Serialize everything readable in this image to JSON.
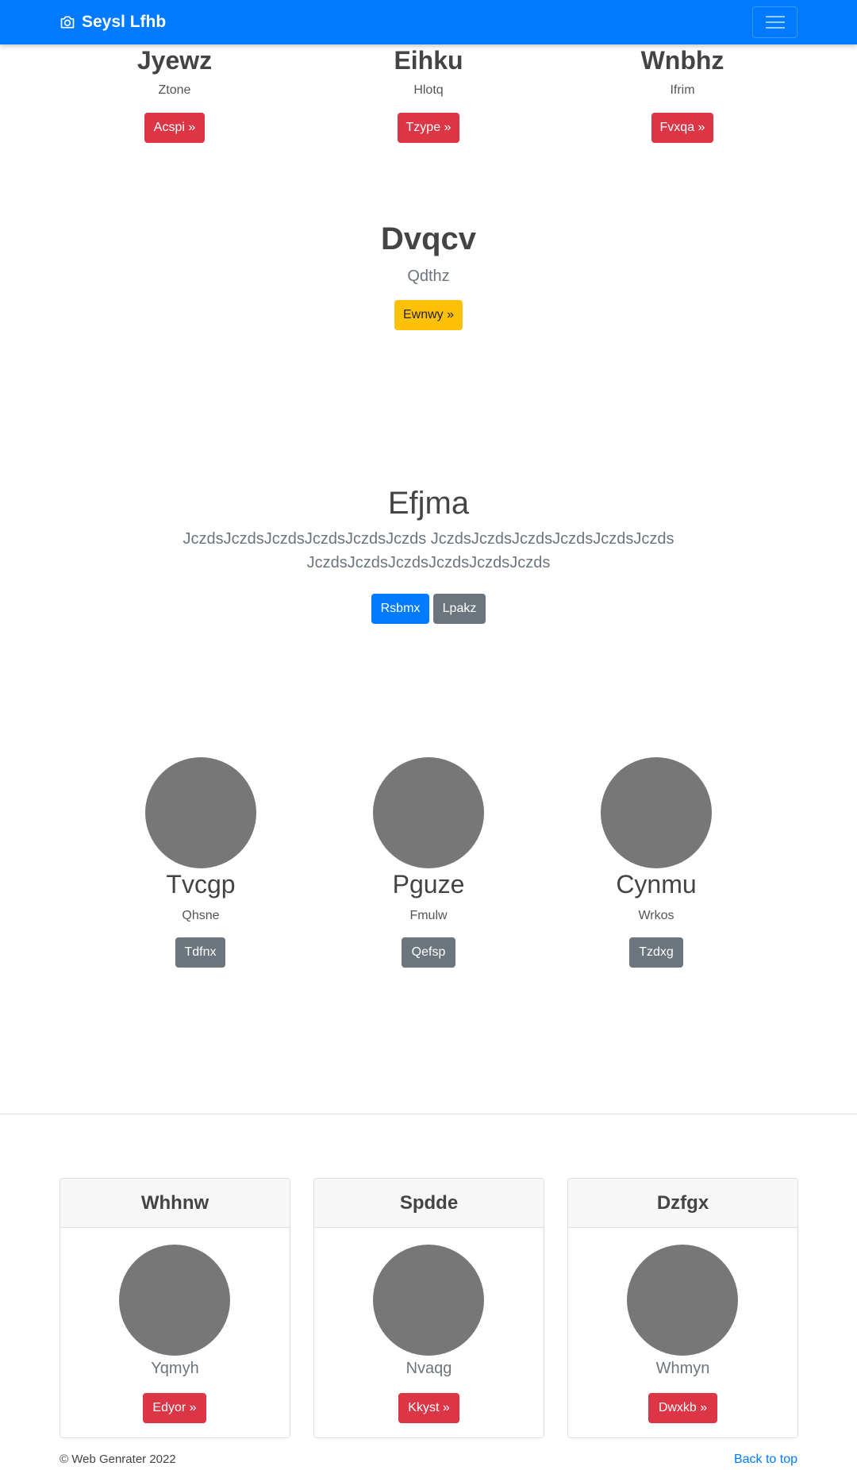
{
  "navbar": {
    "brand": "Seysl Lfhb",
    "camera_icon": "camera-icon",
    "menu_icon": "hamburger-menu-icon"
  },
  "top_columns": [
    {
      "title": "Jyewz",
      "subtitle": "Ztone",
      "button": "Acspi »"
    },
    {
      "title": "Eihku",
      "subtitle": "Hlotq",
      "button": "Tzype »"
    },
    {
      "title": "Wnbhz",
      "subtitle": "Ifrim",
      "button": "Fvxqa »"
    }
  ],
  "feature": {
    "title": "Dvqcv",
    "subtitle": "Qdthz",
    "button": "Ewnwy »"
  },
  "hero": {
    "title": "Efjma",
    "line1": "JczdsJczdsJczdsJczdsJczdsJczds JczdsJczdsJczdsJczdsJczdsJczds",
    "line2": "JczdsJczdsJczdsJczdsJczdsJczds",
    "primary_button": "Rsbmx",
    "secondary_button": "Lpakz"
  },
  "circles": [
    {
      "title": "Tvcgp",
      "subtitle": "Qhsne",
      "button": "Tdfnx"
    },
    {
      "title": "Pguze",
      "subtitle": "Fmulw",
      "button": "Qefsp"
    },
    {
      "title": "Cynmu",
      "subtitle": "Wrkos",
      "button": "Tzdxg"
    }
  ],
  "cards": [
    {
      "header": "Whhnw",
      "subtitle": "Yqmyh",
      "button": "Edyor »"
    },
    {
      "header": "Spdde",
      "subtitle": "Nvaqg",
      "button": "Kkyst »"
    },
    {
      "header": "Dzfgx",
      "subtitle": "Whmyn",
      "button": "Dwxkb »"
    }
  ],
  "footer": {
    "copyright": "© Web Genrater 2022",
    "back_to_top": "Back to top"
  },
  "colors": {
    "navbar": "#007bff",
    "danger": "#dc3545",
    "warning": "#ffc107",
    "primary": "#007bff",
    "secondary": "#6c757d",
    "placeholder": "#777777"
  }
}
